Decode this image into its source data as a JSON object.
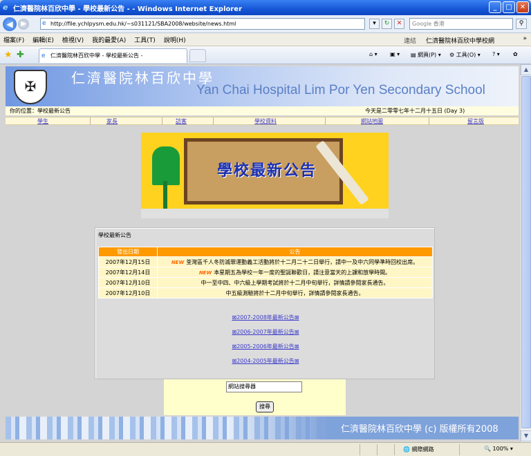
{
  "window": {
    "title": "仁濟醫院林百欣中學 - 學校最新公告 - - Windows Internet Explorer",
    "address": "http://file.ychlpysm.edu.hk/~s031121/SBA2008/website/news.html",
    "search_placeholder": "Google 香港"
  },
  "menu": {
    "items": [
      "檔案(F)",
      "編輯(E)",
      "檢視(V)",
      "我的最愛(A)",
      "工具(T)",
      "說明(H)"
    ],
    "links_label": "連結",
    "links_site": "仁濟醫院林百欣中學校網",
    "chevron": "»"
  },
  "favbar": {
    "tab_label": "仁濟醫院林百欣中學 - 學校最新公告 -",
    "page_cmd": "網頁(P)",
    "tools_cmd": "工具(O)"
  },
  "banner": {
    "title_zh": "仁濟醫院林百欣中學",
    "title_en": "Yan Chai Hospital Lim Por Yen Secondary School"
  },
  "location": {
    "current": "你的位置：學校最新公告",
    "today": "今天是二零零七年十二月十五日 (Day 3)"
  },
  "nav": [
    "學生",
    "家長",
    "訪客",
    "學校資料",
    "網站地圖",
    "留言版"
  ],
  "poster": {
    "title": "學校最新公告"
  },
  "notice": {
    "title": "學校最新公告",
    "headers": [
      "發出日期",
      "公告"
    ],
    "rows": [
      {
        "date": "2007年12月15日",
        "new": "NEW",
        "text": "荃灣區千人冬防滅罪運動義工活動將於十二月二十二日舉行，請中一及中六同學準時回校出席。"
      },
      {
        "date": "2007年12月14日",
        "new": "NEW",
        "text": "本星期五為學校一年一度的聖誕聯歡日，請注意當天的上課和放學時間。"
      },
      {
        "date": "2007年12月10日",
        "new": "",
        "text": "中一至中四、中六級上學期考試將於十二月中旬舉行，詳情請參閱家長通告。"
      },
      {
        "date": "2007年12月10日",
        "new": "",
        "text": "中五級測驗將於十二月中旬舉行，詳情請參閱家長通告。"
      }
    ],
    "archives": [
      "2007-2008年最新公告",
      "2006-2007年最新公告",
      "2005-2006年最新公告",
      "2004-2005年最新公告"
    ]
  },
  "search": {
    "input_value": "網站搜尋器",
    "button": "搜尋"
  },
  "footer": {
    "text": "仁濟醫院林百欣中學 (c) 版權所有2008"
  },
  "status": {
    "zone": "網際網路",
    "zoom": "100%"
  },
  "colors": {
    "table_header": "#ff9900",
    "row_bg": "#fff6c6",
    "link": "#3a3acc",
    "title_bar": "#1556d6"
  }
}
